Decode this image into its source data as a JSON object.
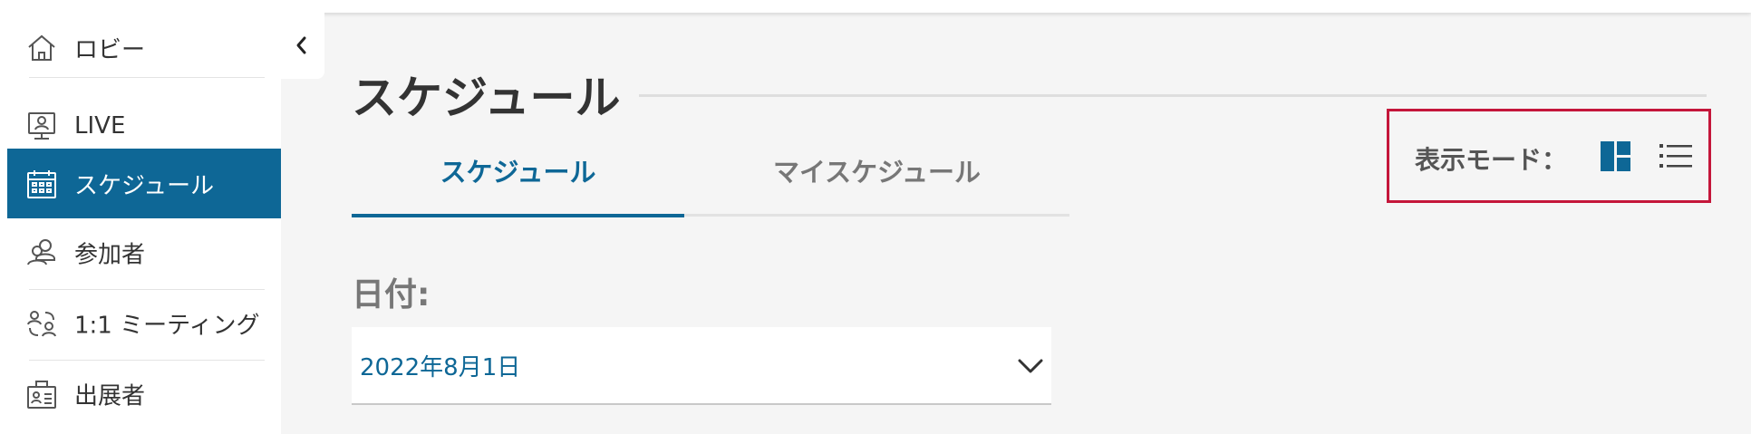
{
  "sidebar": {
    "items": [
      {
        "label": "ロビー",
        "icon": "home-icon",
        "active": false
      },
      {
        "label": "LIVE",
        "icon": "live-presenter-icon",
        "active": false
      },
      {
        "label": "スケジュール",
        "icon": "calendar-icon",
        "active": true
      },
      {
        "label": "参加者",
        "icon": "participants-icon",
        "active": false
      },
      {
        "label": "1:1 ミーティング",
        "icon": "meeting-icon",
        "active": false
      },
      {
        "label": "出展者",
        "icon": "exhibitor-icon",
        "active": false
      }
    ],
    "collapse_icon": "chevron-left-icon"
  },
  "main": {
    "title": "スケジュール",
    "tabs": [
      {
        "label": "スケジュール",
        "active": true
      },
      {
        "label": "マイスケジュール",
        "active": false
      }
    ],
    "date": {
      "label": "日付:",
      "selected": "2022年8月1日",
      "icon": "chevron-down-icon"
    },
    "view_mode": {
      "label": "表示モード：",
      "options": [
        {
          "icon": "grid-view-icon",
          "active": true
        },
        {
          "icon": "list-view-icon",
          "active": false
        }
      ]
    }
  },
  "colors": {
    "accent": "#0e6796",
    "highlight_border": "#c4163a",
    "background": "#f5f5f5"
  }
}
